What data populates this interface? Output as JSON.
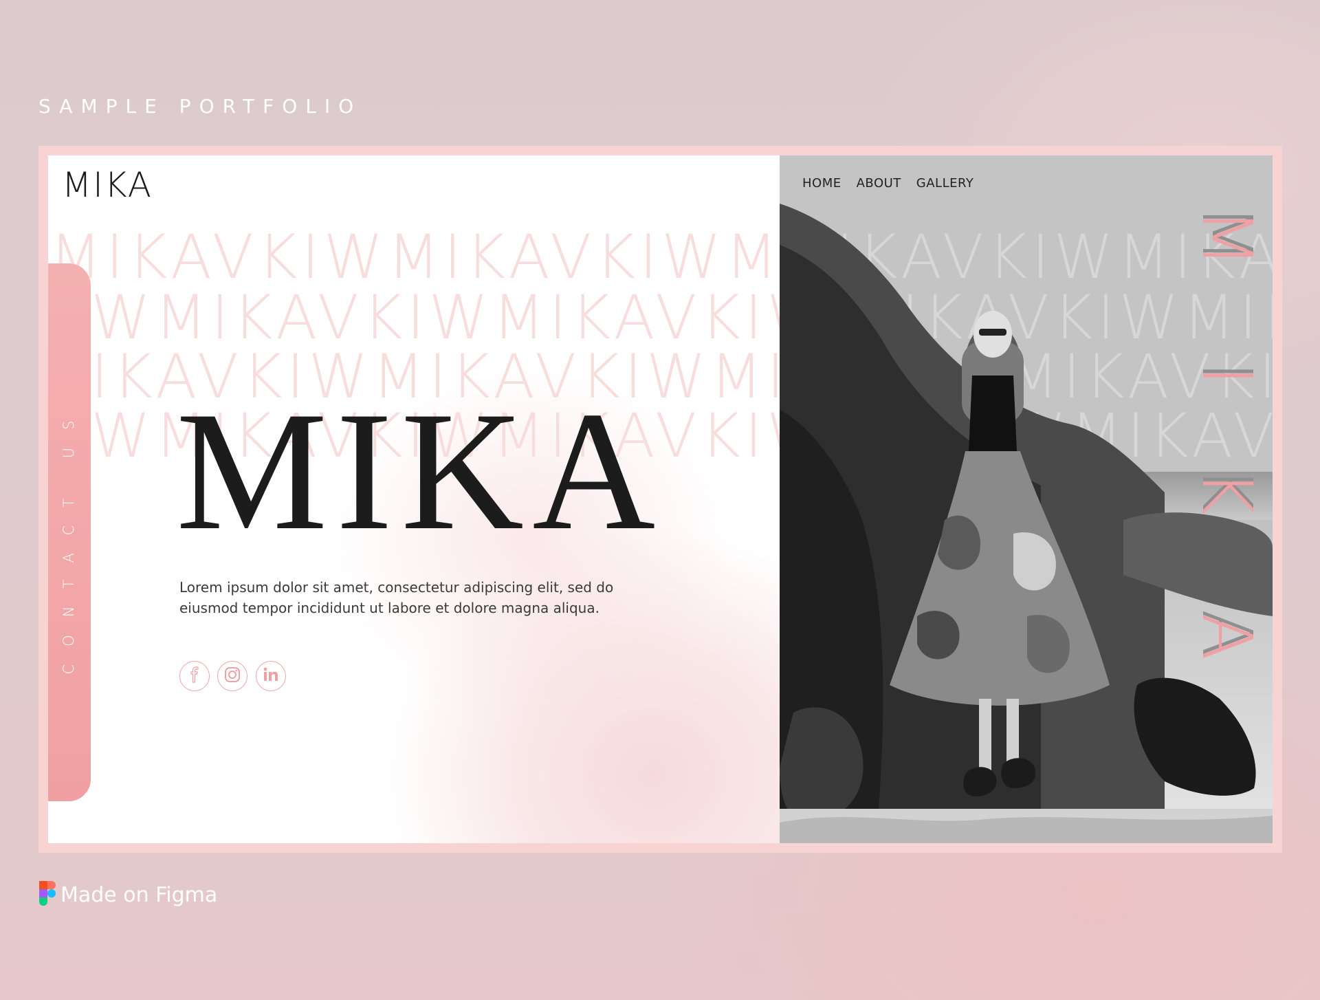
{
  "page": {
    "top_label": "SAMPLE PORTFOLIO"
  },
  "site": {
    "logo": "MIKA",
    "nav": [
      "HOME",
      "ABOUT",
      "GALLERY"
    ],
    "contact_tab": "CONTACT US",
    "hero_title": "MIKA",
    "hero_description": "Lorem ipsum dolor sit amet, consectetur adipiscing elit, sed do eiusmod tempor incididunt ut labore et dolore magna aliqua.",
    "vertical_letters": [
      "M",
      "I",
      "K",
      "A"
    ],
    "social": [
      {
        "icon": "facebook-icon"
      },
      {
        "icon": "instagram-icon"
      },
      {
        "icon": "linkedin-icon"
      }
    ]
  },
  "footer": {
    "made_on": "Made on Figma"
  },
  "colors": {
    "accent_pink": "#f0a0a2",
    "frame_pink": "#f7d3d4",
    "photo_bg": "#c4c4c4",
    "text_dark": "#1c1c1c"
  }
}
